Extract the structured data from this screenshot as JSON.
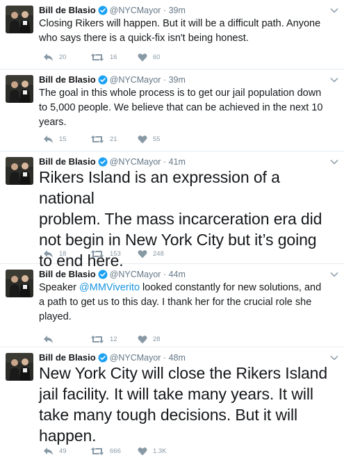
{
  "author": {
    "name": "Bill de Blasio",
    "handle": "@NYCMayor"
  },
  "colors": {
    "text": "#14171a",
    "muted": "#657786",
    "icon": "#8899a6",
    "link": "#1b95e0",
    "verified": "#1da1f2",
    "divider": "#e6ecf0"
  },
  "tweets": [
    {
      "time": "39m",
      "text_lines": [
        "Closing Rikers will happen. But it will be a difficult path. Anyone",
        "who says there is a quick-fix isn't being honest."
      ],
      "replies": "20",
      "retweets": "16",
      "likes": "60"
    },
    {
      "time": "39m",
      "text_lines": [
        "The goal in this whole process is to get our jail population down",
        "to 5,000 people. We believe that can be achieved in the next 10",
        "years."
      ],
      "replies": "15",
      "retweets": "21",
      "likes": "55"
    },
    {
      "time": "41m",
      "text_lines": [
        "Rikers Island is an expression of a national",
        "problem. The mass incarceration era did",
        "not begin in New York City but it’s going",
        "to end here."
      ],
      "replies": "18",
      "retweets": "153",
      "likes": "248"
    },
    {
      "time": "44m",
      "text_prefix": "Speaker ",
      "mention": "@MMViverito",
      "text_suffix": " looked constantly for new solutions, and",
      "text_lines": [
        "a path to get us to this day. I thank her for the crucial role she",
        "played."
      ],
      "replies": "",
      "retweets": "12",
      "likes": "28"
    },
    {
      "time": "48m",
      "text_lines": [
        "New York City will close the Rikers Island",
        "jail facility. It will take many years. It will",
        "take many tough decisions. But it will",
        "happen."
      ],
      "replies": "49",
      "retweets": "666",
      "likes": "1.3K"
    }
  ]
}
